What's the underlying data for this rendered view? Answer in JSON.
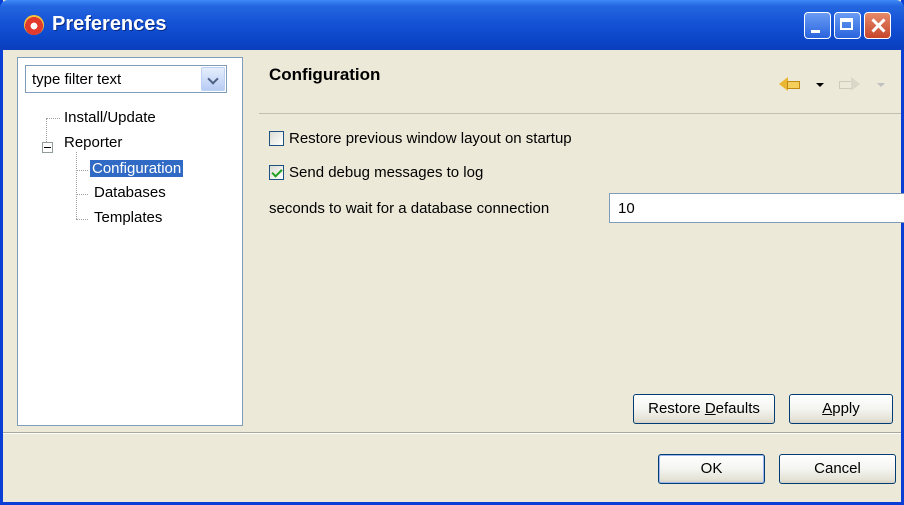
{
  "window": {
    "title": "Preferences"
  },
  "filter": {
    "placeholder": "type filter text"
  },
  "tree": {
    "items": [
      {
        "label": "Install/Update"
      },
      {
        "label": "Reporter"
      },
      {
        "label": "Configuration",
        "selected": true
      },
      {
        "label": "Databases"
      },
      {
        "label": "Templates"
      }
    ]
  },
  "page": {
    "title": "Configuration",
    "restore_layout_label": "Restore previous window layout on startup",
    "restore_layout_checked": false,
    "debug_label": "Send debug messages to log",
    "debug_checked": true,
    "db_wait_label": "seconds to wait for a database connection",
    "db_wait_value": "10"
  },
  "buttons": {
    "restore_defaults_pre": "Restore ",
    "restore_defaults_mnemonic": "D",
    "restore_defaults_post": "efaults",
    "apply_mnemonic": "A",
    "apply_post": "pply",
    "ok": "OK",
    "cancel": "Cancel"
  },
  "colors": {
    "titlebar": "#0a3fd6",
    "selection": "#316ac5",
    "dialog_bg": "#ece9d8"
  }
}
